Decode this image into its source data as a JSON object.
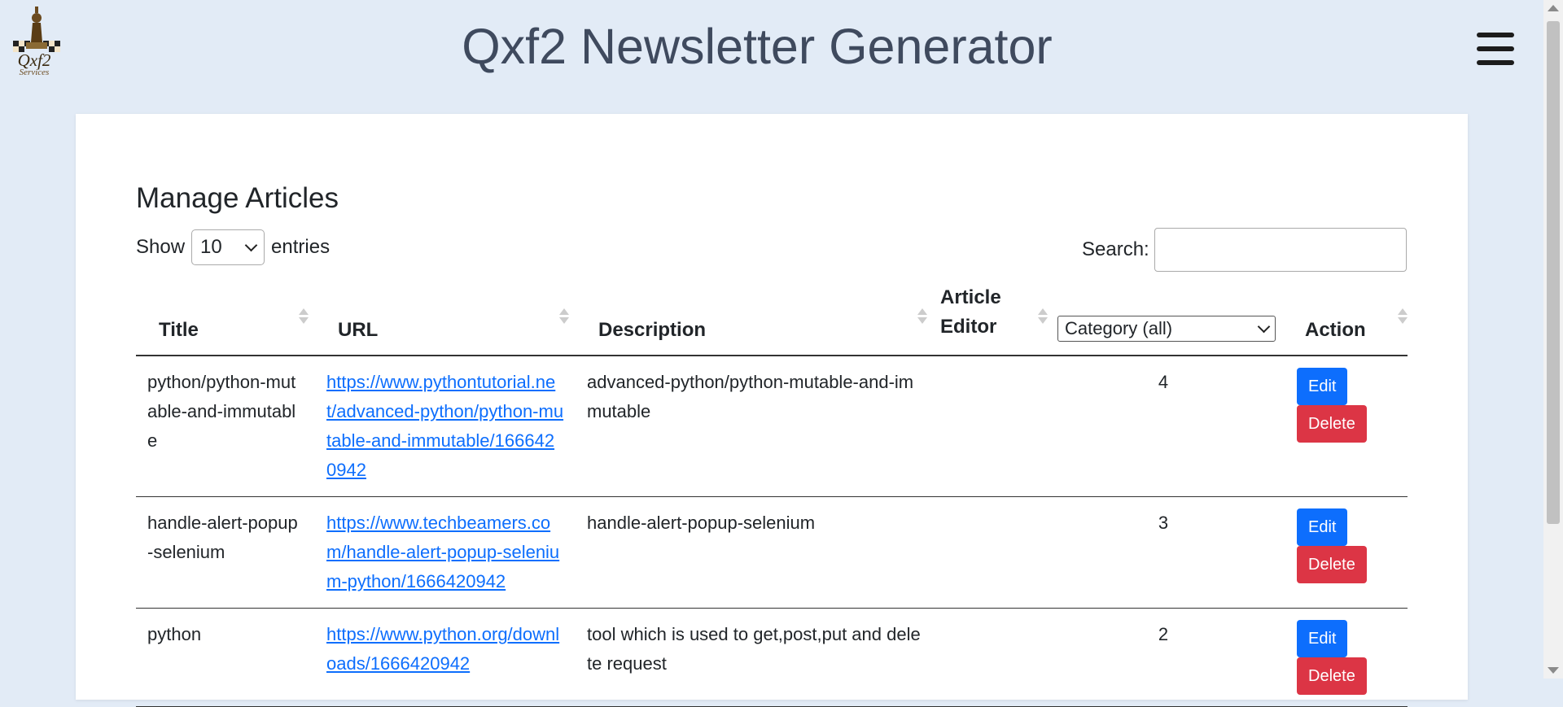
{
  "app": {
    "title": "Qxf2 Newsletter Generator",
    "logo_text": "Qxf2",
    "logo_subtext": "Services"
  },
  "page": {
    "heading": "Manage Articles"
  },
  "controls": {
    "show_label": "Show",
    "entries_value": "10",
    "entries_label": "entries",
    "search_label": "Search:",
    "search_value": ""
  },
  "table": {
    "headers": {
      "title": "Title",
      "url": "URL",
      "description": "Description",
      "article_editor_line1": "Article",
      "article_editor_line2": "Editor",
      "category": "Category (all)",
      "action": "Action"
    },
    "rows": [
      {
        "title": "python/python-mutable-and-immutable",
        "url": "https://www.pythontutorial.net/advanced-python/python-mutable-and-immutable/1666420942",
        "description": "advanced-python/python-mutable-and-immutable",
        "editor": "",
        "category": "4",
        "edit": "Edit",
        "delete": "Delete"
      },
      {
        "title": "handle-alert-popup-selenium",
        "url": "https://www.techbeamers.com/handle-alert-popup-selenium-python/1666420942",
        "description": "handle-alert-popup-selenium",
        "editor": "",
        "category": "3",
        "edit": "Edit",
        "delete": "Delete"
      },
      {
        "title": "python",
        "url": "https://www.python.org/downloads/1666420942",
        "description": "tool which is used to get,post,put and delete request",
        "editor": "",
        "category": "2",
        "edit": "Edit",
        "delete": "Delete"
      }
    ]
  },
  "colors": {
    "page_bg": "#e2ebf6",
    "primary": "#0d6efd",
    "danger": "#dc3545",
    "title": "#3f4a5e"
  }
}
